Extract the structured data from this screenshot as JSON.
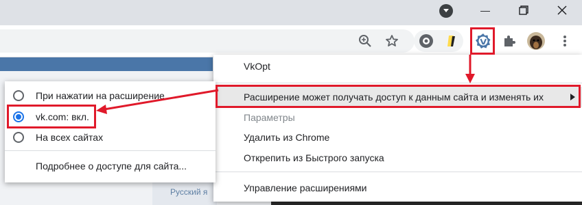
{
  "titlebar": {
    "minimize_glyph": "—",
    "restore_glyph": "❐",
    "close_glyph": "✕"
  },
  "toolbar": {
    "icons": [
      "zoom-icon",
      "star-icon",
      "extension-cookie-icon",
      "extension-yellow-icon",
      "vkopt-extension-icon",
      "puzzle-icon",
      "avatar",
      "kebab-menu-icon"
    ]
  },
  "main_menu": {
    "title": "VkOpt",
    "site_access": "Расширение может получать доступ к данным сайта и изменять их",
    "options": "Параметры",
    "remove": "Удалить из Chrome",
    "unpin": "Открепить из Быстрого запуска",
    "manage": "Управление расширениями"
  },
  "sub_menu": {
    "on_click": "При нажатии на расширение",
    "on_site": "vk.com: вкл.",
    "all_sites": "На всех сайтах",
    "more": "Подробнее о доступе для сайта..."
  },
  "page": {
    "lang": "Русский я"
  },
  "colors": {
    "annotation_red": "#e0192a",
    "accent_blue": "#1a73e8",
    "vk_blue": "#4a76a8"
  }
}
